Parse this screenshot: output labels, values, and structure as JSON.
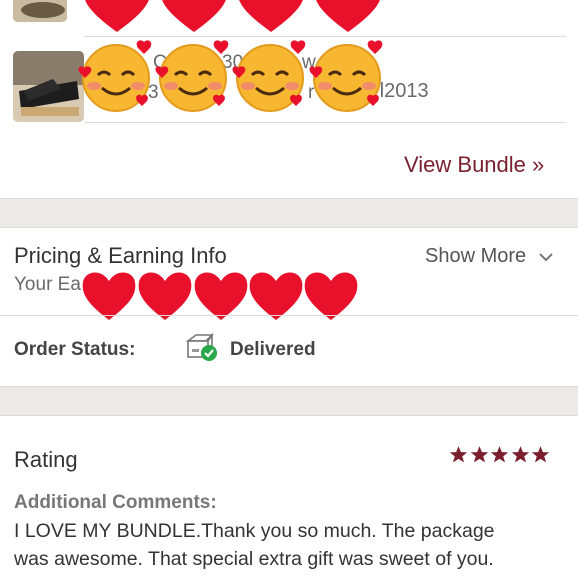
{
  "bundle": {
    "item_text_fragment_a": "C",
    "item_text_fragment_b": "30",
    "item_text_fragment_c": "w",
    "item_text_fragment_d": "3",
    "item_text_fragment_e": "r",
    "item_text_fragment_f": "rl2013",
    "view_bundle_label": "View Bundle »"
  },
  "pricing": {
    "title": "Pricing & Earning Info",
    "show_more_label": "Show More",
    "earnings_label_partial": "Your Ea"
  },
  "order": {
    "status_label": "Order Status:",
    "status_value": "Delivered"
  },
  "rating": {
    "title": "Rating",
    "stars": 5,
    "max_stars": 5,
    "comments_label": "Additional Comments:",
    "comment_line_1": "I LOVE MY BUNDLE.Thank you so much. The package",
    "comment_line_2": "was awesome. That special extra gift was sweet of you."
  },
  "colors": {
    "accent": "#7a1f2e",
    "success": "#2aa84a",
    "heart": "#e8102a"
  }
}
